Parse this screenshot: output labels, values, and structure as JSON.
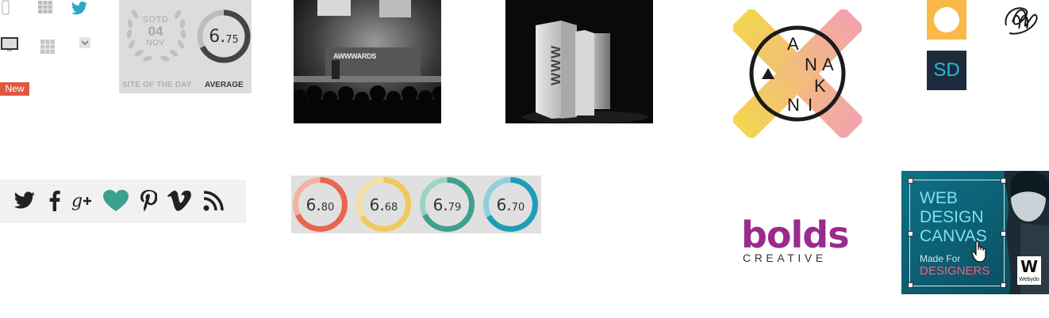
{
  "top_left": {
    "new_badge": "New",
    "icons": [
      "phone-icon",
      "grid-icon",
      "twitter-icon",
      "desktop-icon",
      "grid-icon",
      "chevron-down-icon"
    ]
  },
  "sotd_card": {
    "label": "SOTD",
    "day": "04",
    "month": "NOV",
    "caption_left": "SITE OF THE DAY",
    "caption_right": "AVERAGE",
    "score_int": "6.",
    "score_dec": "75",
    "score_fraction": 0.675,
    "ring_color": "#444444"
  },
  "photos": {
    "stage_banner": "AWWWARDS",
    "trophy_text": "WWW"
  },
  "social_icons": [
    "twitter-icon",
    "facebook-icon",
    "google-plus-icon",
    "heart-icon",
    "pinterest-icon",
    "vimeo-icon",
    "rss-icon"
  ],
  "score_strip": [
    {
      "int": "6.",
      "dec": "80",
      "fraction": 0.68,
      "color": "#e8664f",
      "track": "#f2b3a3"
    },
    {
      "int": "6.",
      "dec": "68",
      "fraction": 0.668,
      "color": "#f0c85c",
      "track": "#f6deA0"
    },
    {
      "int": "6.",
      "dec": "79",
      "fraction": 0.679,
      "color": "#3fa08e",
      "track": "#9fd2c6"
    },
    {
      "int": "6.",
      "dec": "70",
      "fraction": 0.67,
      "color": "#1e9eb4",
      "track": "#8fd0dc"
    }
  ],
  "logos": {
    "anakni_letters": [
      "A",
      "N",
      "A",
      "K",
      "N",
      "I"
    ],
    "sd_text": "SD",
    "bolds_word": "bolds",
    "bolds_sub": "CREATIVE"
  },
  "web_design_canvas": {
    "line1": "WEB",
    "line2": "DESIGN",
    "line3": "CANVAS",
    "made_for": "Made For",
    "designers": "DESIGNERS",
    "brand_letter": "W",
    "brand_name": "Webydo"
  }
}
